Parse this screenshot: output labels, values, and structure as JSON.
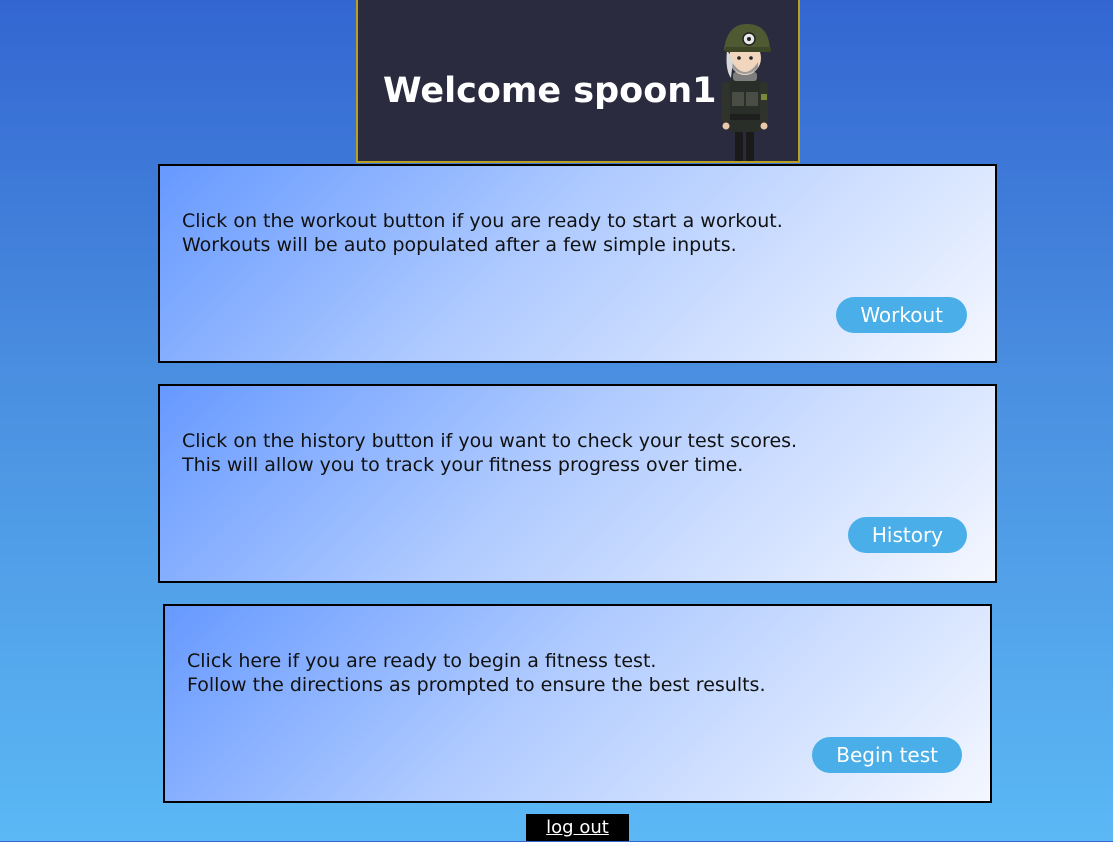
{
  "header": {
    "title": "Welcome spoon1",
    "avatar_icon": "soldier-avatar-icon"
  },
  "cards": [
    {
      "line1": "Click on the workout button if you are ready to start a workout.",
      "line2": "Workouts will be auto populated after a few simple inputs.",
      "button_label": "Workout"
    },
    {
      "line1": "Click on the history button if you want to check your test scores.",
      "line2": "This will allow you to track your fitness progress over time.",
      "button_label": "History"
    },
    {
      "line1": "Click here if you are ready to begin a fitness test.",
      "line2": "Follow the directions as prompted to ensure the best results.",
      "button_label": "Begin test"
    }
  ],
  "footer": {
    "logout_label": "log out"
  },
  "colors": {
    "header_bg": "#2b2b40",
    "header_border": "#b9a020",
    "button_bg": "#4aaee8",
    "logout_bg": "#000000"
  }
}
